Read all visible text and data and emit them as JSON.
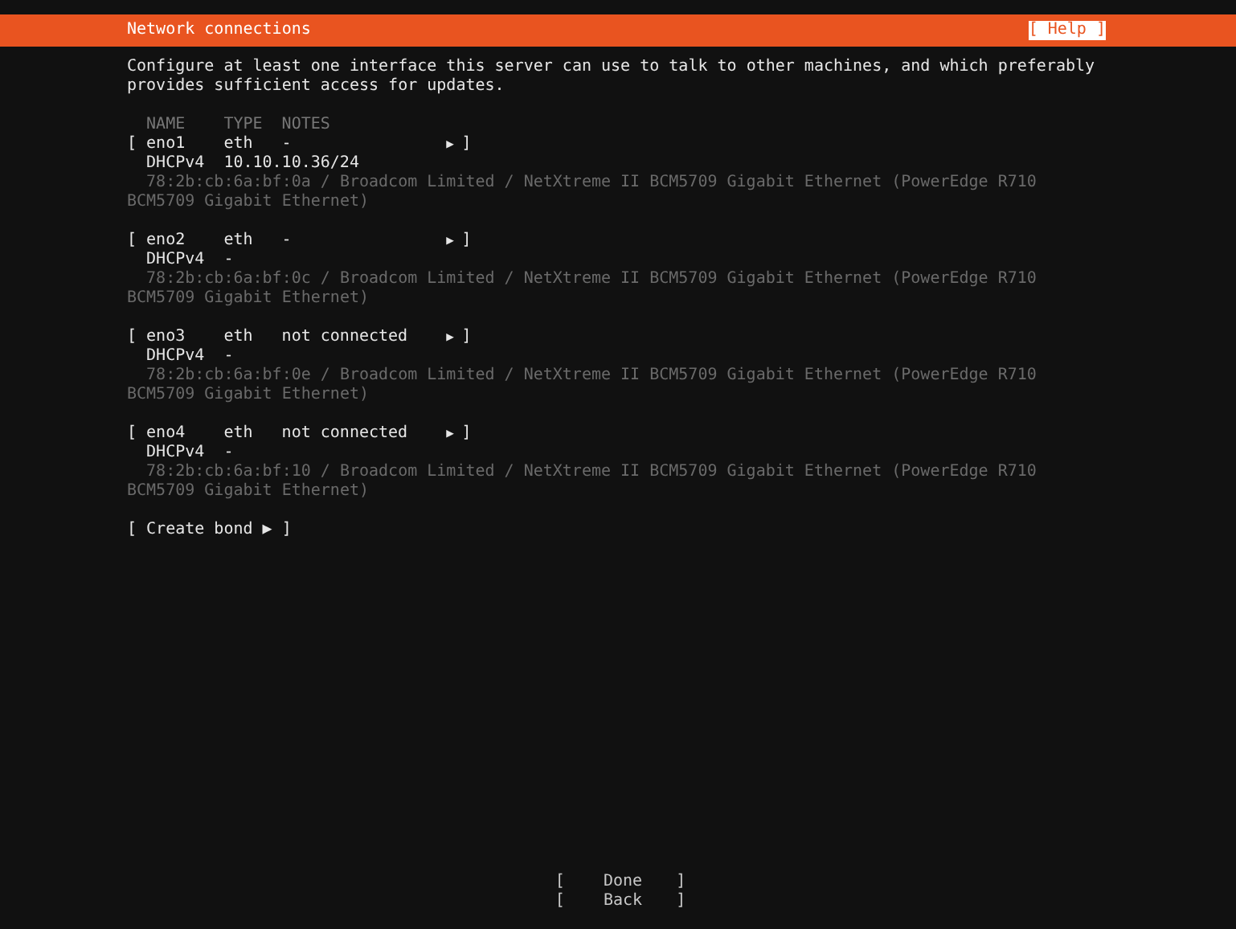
{
  "header": {
    "title": "Network connections",
    "help_button": "Help"
  },
  "brackets": {
    "open": "[",
    "close": "]"
  },
  "intro": "Configure at least one interface this server can use to talk to other machines, and which preferably provides sufficient access for updates.",
  "table": {
    "columns": [
      "NAME",
      "TYPE",
      "NOTES"
    ],
    "rows": [
      {
        "name": "eno1",
        "type": "eth",
        "notes": "-",
        "arrow": "▶",
        "addresses": [
          {
            "method": "DHCPv4",
            "value": "10.10.10.36/24"
          }
        ],
        "description": "78:2b:cb:6a:bf:0a / Broadcom Limited / NetXtreme II BCM5709 Gigabit Ethernet (PowerEdge R710 BCM5709 Gigabit Ethernet)"
      },
      {
        "name": "eno2",
        "type": "eth",
        "notes": "-",
        "arrow": "▶",
        "addresses": [
          {
            "method": "DHCPv4",
            "value": "-"
          }
        ],
        "description": "78:2b:cb:6a:bf:0c / Broadcom Limited / NetXtreme II BCM5709 Gigabit Ethernet (PowerEdge R710 BCM5709 Gigabit Ethernet)"
      },
      {
        "name": "eno3",
        "type": "eth",
        "notes": "not connected",
        "arrow": "▶",
        "addresses": [
          {
            "method": "DHCPv4",
            "value": "-"
          }
        ],
        "description": "78:2b:cb:6a:bf:0e / Broadcom Limited / NetXtreme II BCM5709 Gigabit Ethernet (PowerEdge R710 BCM5709 Gigabit Ethernet)"
      },
      {
        "name": "eno4",
        "type": "eth",
        "notes": "not connected",
        "arrow": "▶",
        "addresses": [
          {
            "method": "DHCPv4",
            "value": "-"
          }
        ],
        "description": "78:2b:cb:6a:bf:10 / Broadcom Limited / NetXtreme II BCM5709 Gigabit Ethernet (PowerEdge R710 BCM5709 Gigabit Ethernet)"
      }
    ]
  },
  "create_bond": {
    "label": "Create bond",
    "arrow": "▶"
  },
  "buttons": [
    "Done",
    "Back"
  ]
}
